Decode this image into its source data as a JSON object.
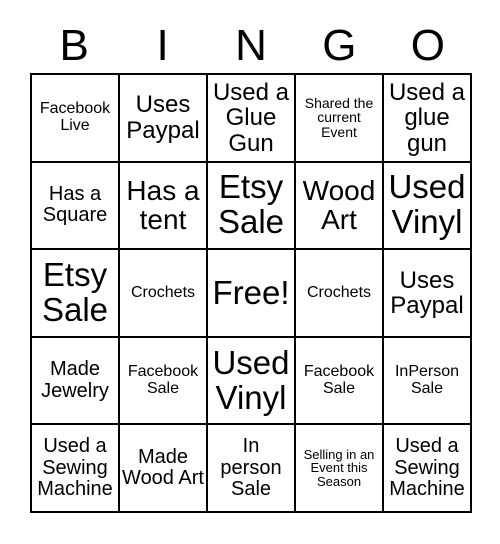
{
  "card": {
    "header_letters": [
      "B",
      "I",
      "N",
      "G",
      "O"
    ],
    "free_space_label": "Free!",
    "colors": {
      "background": "#ffffff",
      "text": "#000000",
      "grid_line": "#000000"
    },
    "rows": [
      [
        {
          "text": "Facebook Live",
          "size": "sm"
        },
        {
          "text": "Uses Paypal",
          "size": "lg"
        },
        {
          "text": "Used a Glue Gun",
          "size": "lg"
        },
        {
          "text": "Shared the current Event",
          "size": "xs"
        },
        {
          "text": "Used a glue gun",
          "size": "lg"
        }
      ],
      [
        {
          "text": "Has a Square",
          "size": "md"
        },
        {
          "text": "Has a tent",
          "size": "xl"
        },
        {
          "text": "Etsy Sale",
          "size": "xxl"
        },
        {
          "text": "Wood Art",
          "size": "xl"
        },
        {
          "text": "Used Vinyl",
          "size": "xxl"
        }
      ],
      [
        {
          "text": "Etsy Sale",
          "size": "xxl"
        },
        {
          "text": "Crochets",
          "size": "sm"
        },
        {
          "text": "Free!",
          "size": "xxl"
        },
        {
          "text": "Crochets",
          "size": "sm"
        },
        {
          "text": "Uses Paypal",
          "size": "lg"
        }
      ],
      [
        {
          "text": "Made Jewelry",
          "size": "md"
        },
        {
          "text": "Facebook Sale",
          "size": "sm"
        },
        {
          "text": "Used Vinyl",
          "size": "xxl"
        },
        {
          "text": "Facebook Sale",
          "size": "sm"
        },
        {
          "text": "InPerson Sale",
          "size": "sm"
        }
      ],
      [
        {
          "text": "Used a Sewing Machine",
          "size": "md"
        },
        {
          "text": "Made Wood Art",
          "size": "md"
        },
        {
          "text": "In person Sale",
          "size": "md"
        },
        {
          "text": "Selling in an Event this Season",
          "size": "xxs"
        },
        {
          "text": "Used a Sewing Machine",
          "size": "md"
        }
      ]
    ]
  }
}
